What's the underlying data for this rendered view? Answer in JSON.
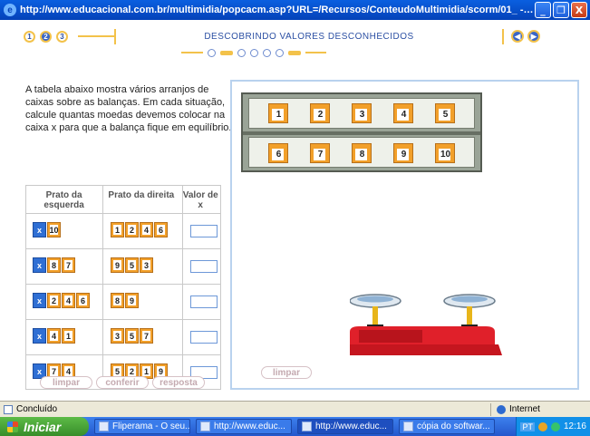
{
  "window": {
    "title": "http://www.educacional.com.br/multimidia/popcacm.asp?URL=/Recursos/ConteudoMultimidia/scorm/01_ - Mic...",
    "buttons": [
      "_",
      "❐",
      "X"
    ]
  },
  "nav": {
    "steps": [
      "1",
      "2",
      "3"
    ],
    "active_step": 2,
    "header": "DESCOBRINDO VALORES DESCONHECIDOS",
    "prev_icon": "back-arrow-icon",
    "next_icon": "forward-arrow-icon"
  },
  "intro": {
    "text": "A tabela abaixo mostra vários arranjos de caixas sobre as balanças. Em cada situação, calcule quantas moedas devemos colocar na caixa x para que a balança fique em equilíbrio."
  },
  "table": {
    "headers": [
      "Prato da esquerda",
      "Prato da direita",
      "Valor de x"
    ],
    "rows": [
      {
        "left": [
          "x",
          "10"
        ],
        "right": [
          "1",
          "2",
          "4",
          "6"
        ],
        "answer": ""
      },
      {
        "left": [
          "x",
          "8",
          "7"
        ],
        "right": [
          "9",
          "5",
          "3"
        ],
        "answer": ""
      },
      {
        "left": [
          "x",
          "2",
          "4",
          "6"
        ],
        "right": [
          "8",
          "9"
        ],
        "answer": ""
      },
      {
        "left": [
          "x",
          "4",
          "1"
        ],
        "right": [
          "3",
          "5",
          "7"
        ],
        "answer": ""
      },
      {
        "left": [
          "x",
          "7",
          "4"
        ],
        "right": [
          "5",
          "2",
          "1",
          "9"
        ],
        "answer": ""
      }
    ]
  },
  "buttons": {
    "clear": "limpar",
    "check": "conferir",
    "answer": "resposta",
    "clear_panel": "limpar"
  },
  "shelf": {
    "top": [
      "1",
      "2",
      "3",
      "4",
      "5"
    ],
    "bottom": [
      "6",
      "7",
      "8",
      "9",
      "10"
    ]
  },
  "status": {
    "text": "Concluído",
    "zone": "Internet"
  },
  "taskbar": {
    "start": "Iniciar",
    "tasks": [
      "Fliperama - O seu...",
      "http://www.educ...",
      "http://www.educ...",
      "cópia do softwar..."
    ],
    "active_task": 2,
    "lang": "PT",
    "clock": "12:16"
  },
  "colors": {
    "box_orange": "#f2a02a",
    "box_blue": "#2f6fd4",
    "accent_yellow": "#f3c24a",
    "scale_red": "#e0202a"
  }
}
